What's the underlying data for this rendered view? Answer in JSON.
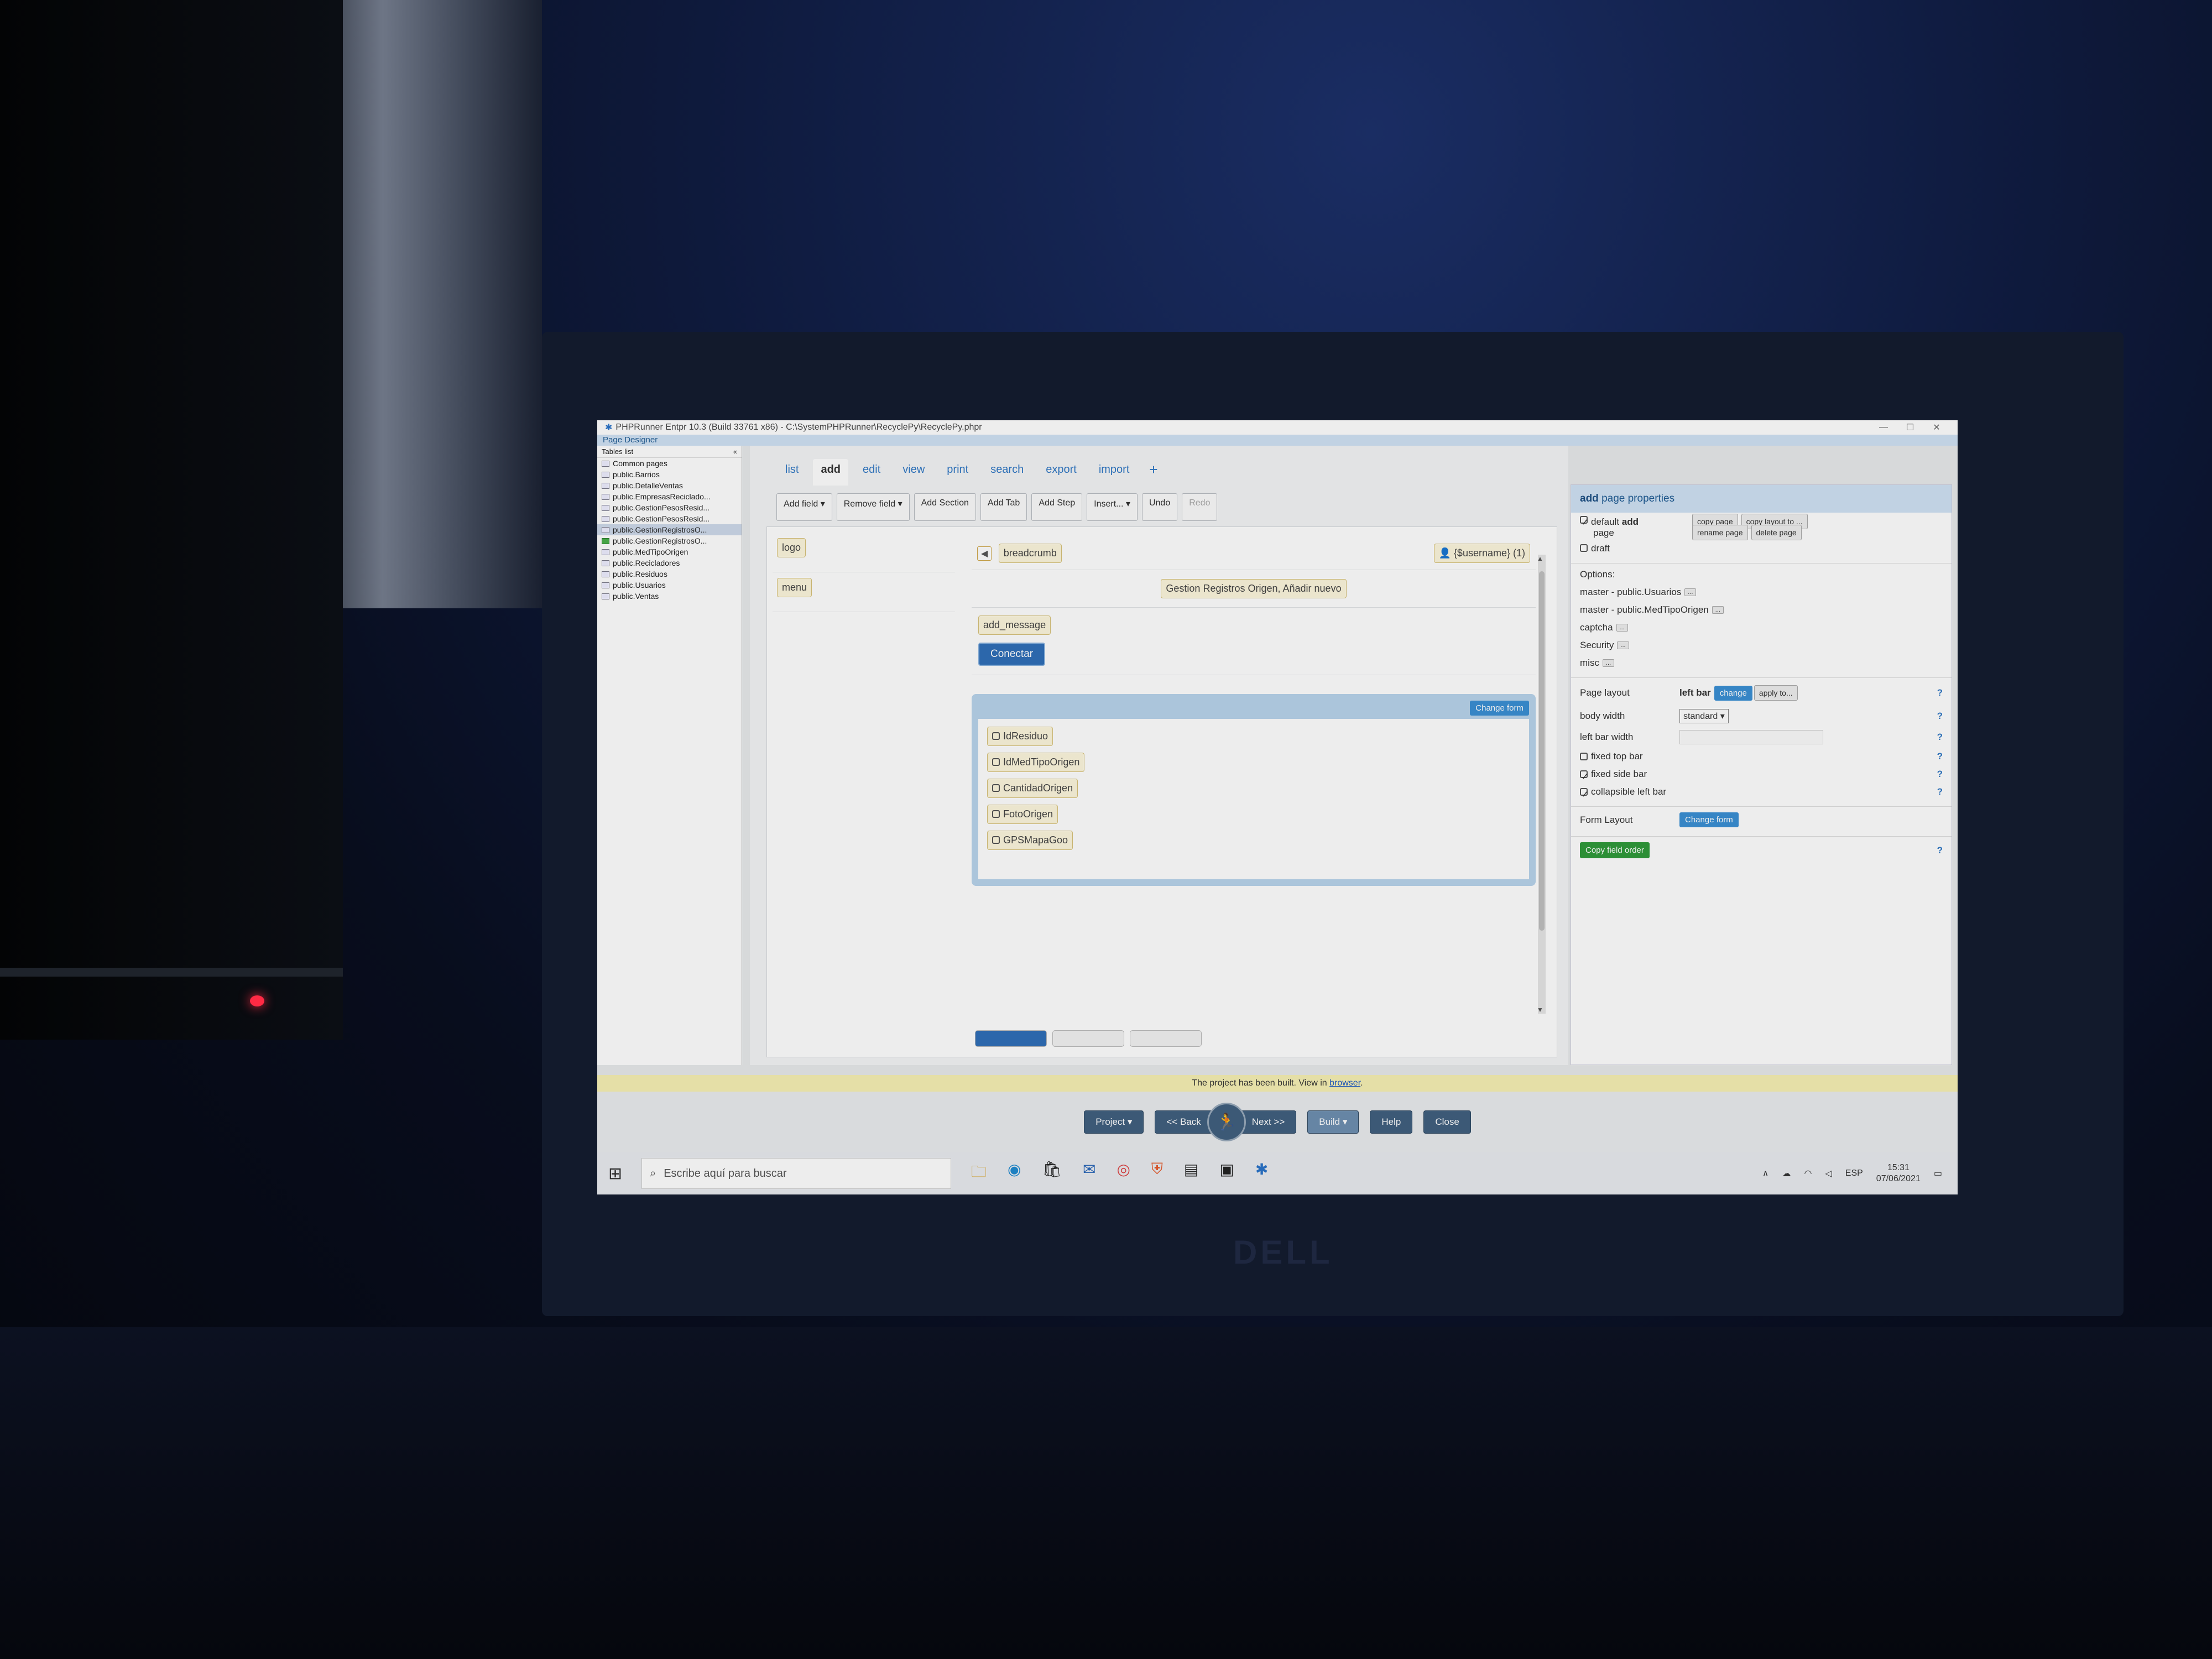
{
  "window": {
    "title": "PHPRunner Entpr 10.3 (Build 33761 x86) - C:\\SystemPHPRunner\\RecyclePy\\RecyclePy.phpr",
    "subtitle": "Page Designer"
  },
  "sidebar": {
    "header": "Tables list",
    "collapse": "«",
    "items": [
      {
        "label": "Common pages"
      },
      {
        "label": "public.Barrios"
      },
      {
        "label": "public.DetalleVentas"
      },
      {
        "label": "public.EmpresasReciclado..."
      },
      {
        "label": "public.GestionPesosResid..."
      },
      {
        "label": "public.GestionPesosResid..."
      },
      {
        "label": "public.GestionRegistrosO..."
      },
      {
        "label": "public.GestionRegistrosO..."
      },
      {
        "label": "public.MedTipoOrigen"
      },
      {
        "label": "public.Recicladores"
      },
      {
        "label": "public.Residuos"
      },
      {
        "label": "public.Usuarios"
      },
      {
        "label": "public.Ventas"
      }
    ]
  },
  "tabs": [
    "list",
    "add",
    "edit",
    "view",
    "print",
    "search",
    "export",
    "import",
    "+"
  ],
  "toolbar": [
    "Add field ▾",
    "Remove field ▾",
    "Add Section",
    "Add Tab",
    "Add Step",
    "Insert... ▾",
    "Undo",
    "Redo"
  ],
  "canvas": {
    "logo": "logo",
    "menu": "menu",
    "breadcrumb": "breadcrumb",
    "username": "{$username} (1)",
    "page_title": "Gestion Registros Origen, Añadir nuevo",
    "add_message": "add_message",
    "connect": "Conectar",
    "change_form": "Change form",
    "fields": [
      "IdResiduo",
      "IdMedTipoOrigen",
      "CantidadOrigen",
      "FotoOrigen",
      "GPSMapaGoo"
    ]
  },
  "props": {
    "head_bold": "add",
    "head_rest": "page properties",
    "default_prefix": "default",
    "default_bold": "add",
    "default_suffix": "page",
    "draft": "draft",
    "copy_page": "copy page",
    "copy_layout": "copy layout to ...",
    "rename_page": "rename page",
    "delete_page": "delete page",
    "options": "Options:",
    "master1": "master - public.Usuarios",
    "master2": "master - public.MedTipoOrigen",
    "captcha": "captcha",
    "security": "Security",
    "misc": "misc",
    "dots": "...",
    "page_layout": "Page layout",
    "page_layout_value": "left bar",
    "change": "change",
    "apply_to": "apply to...",
    "body_width": "body width",
    "body_width_value": "standard",
    "left_bar_width": "left bar width",
    "fixed_top_bar": "fixed top bar",
    "fixed_side_bar": "fixed side bar",
    "collapsible_left_bar": "collapsible left bar",
    "form_layout": "Form Layout",
    "change_form": "Change form",
    "copy_field_order": "Copy field order",
    "help": "?"
  },
  "notice": {
    "text": "The project has been built. View in",
    "link": "browser",
    "end": "."
  },
  "footer": {
    "project": "Project ▾",
    "back": "<< Back",
    "next": "Next >>",
    "build": "Build ▾",
    "help": "Help",
    "close": "Close"
  },
  "taskbar": {
    "search_placeholder": "Escribe aquí para buscar",
    "lang": "ESP",
    "time": "15:31",
    "date": "07/06/2021"
  },
  "brand": "DELL",
  "colors": {
    "accent": "#2f77c4",
    "button_blue": "#2f6fb8",
    "footer_button": "#41607f",
    "notice": "#f6f0b4"
  }
}
